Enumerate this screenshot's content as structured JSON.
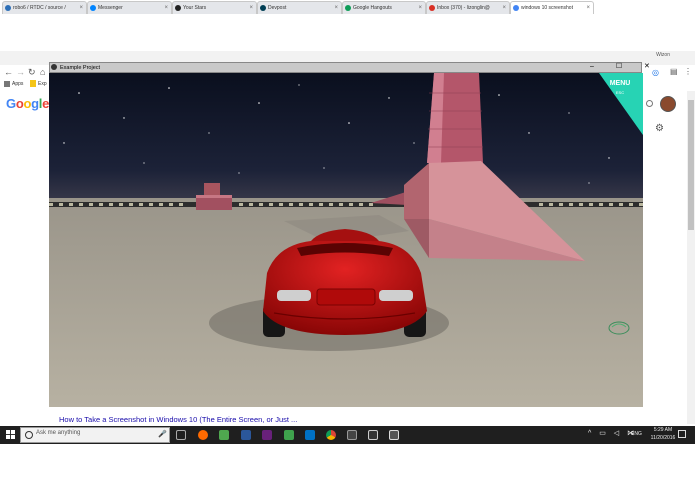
{
  "browser": {
    "tabs": [
      {
        "label": "robo6 / RTDC / source /",
        "color": "#2d6fb7"
      },
      {
        "label": "Messenger",
        "color": "#0084ff"
      },
      {
        "label": "Your Stars",
        "color": "#222222"
      },
      {
        "label": "Devpost",
        "color": "#003e54"
      },
      {
        "label": "Google Hangouts",
        "color": "#0f9d58"
      },
      {
        "label": "Inbox (370) - lizonglin@",
        "color": "#d93025"
      },
      {
        "label": "windows 10 screenshot",
        "color": "#4285f4"
      }
    ],
    "window_label": "Wizon",
    "bookmarks": {
      "apps": "Apps",
      "item": "Exp"
    },
    "nav_icons": {
      "back": "back-arrow-icon",
      "forward": "forward-arrow-icon",
      "reload": "reload-icon",
      "home": "home-icon"
    }
  },
  "google_page": {
    "logo": "Google",
    "result_link": "How to Take a Screenshot in Windows 10 (The Entire Screen, or Just ..."
  },
  "game_window": {
    "title": "Example Project",
    "controls": "– ☐ ✕",
    "menu_label": "MENU",
    "menu_sub": "ESC",
    "menu_color": "#27d3b4"
  },
  "taskbar": {
    "search_placeholder": "Ask me anything",
    "language": "ENG",
    "time": "5:29 AM",
    "date": "11/20/2016",
    "app_icon_colors": [
      "#8a8a8a",
      "#ff6a00",
      "#4fa84f",
      "#2b579a",
      "#68217a",
      "#3fa34d",
      "#0072c6",
      "#db4437",
      "#444444",
      "#bbbbbb",
      "#cccccc"
    ]
  }
}
